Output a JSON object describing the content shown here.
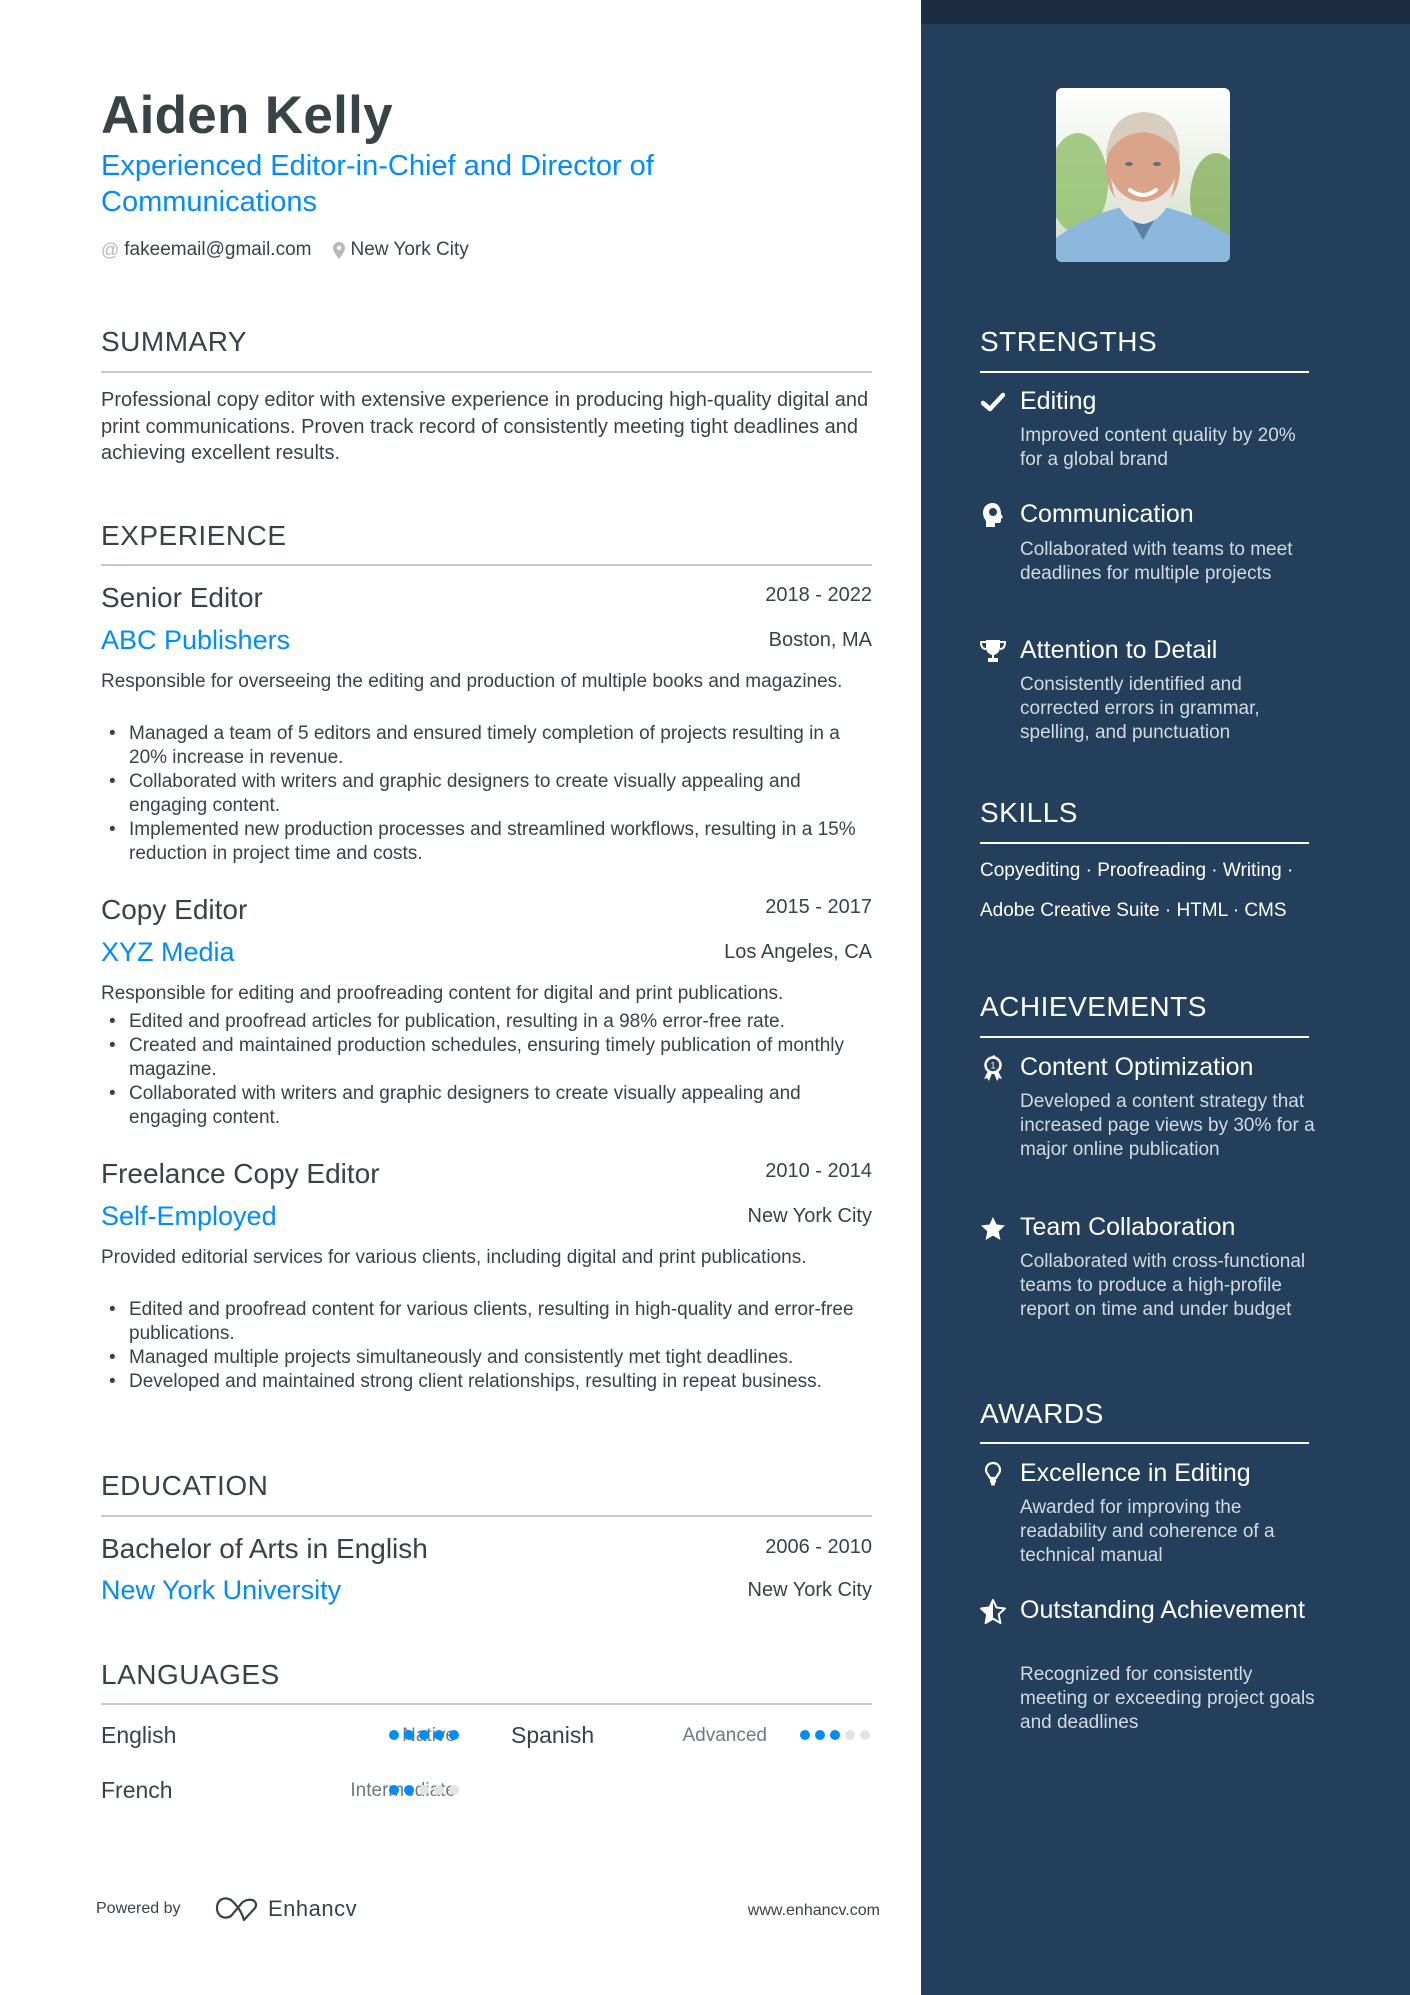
{
  "header": {
    "name": "Aiden Kelly",
    "headline": "Experienced Editor-in-Chief and Director of Communications",
    "email": "fakeemail@gmail.com",
    "location": "New York City",
    "email_icon": "at-icon",
    "location_icon": "map-pin-icon"
  },
  "summary": {
    "title": "SUMMARY",
    "text": "Professional copy editor with extensive experience in producing high-quality digital and print communications. Proven track record of consistently meeting tight deadlines and achieving excellent results."
  },
  "experience": {
    "title": "EXPERIENCE",
    "items": [
      {
        "role": "Senior Editor",
        "dates": "2018 - 2022",
        "company": "ABC Publishers",
        "location": "Boston, MA",
        "description": "Responsible for overseeing the editing and production of multiple books and magazines.",
        "bullets": [
          "Managed a team of 5 editors and ensured timely completion of projects resulting in a 20% increase in revenue.",
          "Collaborated with writers and graphic designers to create visually appealing and engaging content.",
          "Implemented new production processes and streamlined workflows, resulting in a 15% reduction in project time and costs."
        ]
      },
      {
        "role": "Copy Editor",
        "dates": "2015 - 2017",
        "company": "XYZ Media",
        "location": "Los Angeles, CA",
        "description": "Responsible for editing and proofreading content for digital and print publications.",
        "bullets": [
          "Edited and proofread articles for publication, resulting in a 98% error-free rate.",
          "Created and maintained production schedules, ensuring timely publication of monthly magazine.",
          "Collaborated with writers and graphic designers to create visually appealing and engaging content."
        ]
      },
      {
        "role": "Freelance Copy Editor",
        "dates": "2010 - 2014",
        "company": "Self-Employed",
        "location": "New York City",
        "description": "Provided editorial services for various clients, including digital and print publications.",
        "bullets": [
          "Edited and proofread content for various clients, resulting in high-quality and error-free publications.",
          "Managed multiple projects simultaneously and consistently met tight deadlines.",
          "Developed and maintained strong client relationships, resulting in repeat business."
        ]
      }
    ]
  },
  "education": {
    "title": "EDUCATION",
    "items": [
      {
        "degree": "Bachelor of Arts in English",
        "dates": "2006 - 2010",
        "school": "New York University",
        "location": "New York City"
      }
    ]
  },
  "languages": {
    "title": "LANGUAGES",
    "items": [
      {
        "name": "English",
        "level": "Native",
        "rating": 5,
        "max": 5
      },
      {
        "name": "Spanish",
        "level": "Advanced",
        "rating": 3,
        "max": 5
      },
      {
        "name": "French",
        "level": "Intermediate",
        "rating": 2,
        "max": 5
      }
    ]
  },
  "footer": {
    "powered_by": "Powered by",
    "brand": "Enhancv",
    "website": "www.enhancv.com"
  },
  "sidebar": {
    "photo_alt": "Profile photo of Aiden Kelly",
    "strengths": {
      "title": "STRENGTHS",
      "items": [
        {
          "icon": "check-icon",
          "title": "Editing",
          "description": "Improved content quality by 20% for a global brand"
        },
        {
          "icon": "head-icon",
          "title": "Communication",
          "description": "Collaborated with teams to meet deadlines for multiple projects"
        },
        {
          "icon": "trophy-icon",
          "title": "Attention to Detail",
          "description": "Consistently identified and corrected errors in grammar, spelling, and punctuation"
        }
      ]
    },
    "skills": {
      "title": "SKILLS",
      "line1": "Copyediting · Proofreading · Writing ·",
      "line2": "Adobe Creative Suite · HTML · CMS",
      "items": [
        "Copyediting",
        "Proofreading",
        "Writing",
        "Adobe Creative Suite",
        "HTML",
        "CMS"
      ]
    },
    "achievements": {
      "title": "ACHIEVEMENTS",
      "items": [
        {
          "icon": "award-ribbon-icon",
          "title": "Content Optimization",
          "description": "Developed a content strategy that increased page views by 30% for a major online publication"
        },
        {
          "icon": "star-icon",
          "title": "Team Collaboration",
          "description": "Collaborated with cross-functional teams to produce a high-profile report on time and under budget"
        }
      ]
    },
    "awards": {
      "title": "AWARDS",
      "items": [
        {
          "icon": "lightbulb-icon",
          "title": "Excellence in Editing",
          "description": "Awarded for improving the readability and coherence of a technical manual"
        },
        {
          "icon": "half-star-icon",
          "title": "Outstanding Achievement",
          "description": "Recognized for consistently meeting or exceeding project goals and deadlines"
        }
      ]
    }
  },
  "colors": {
    "accent": "#008cff",
    "text": "#384347",
    "sidebar_bg": "#233f5c",
    "sidebar_top": "#1b2c42",
    "divider": "#c9c9c9",
    "dot_inactive": "#e3e3e3"
  }
}
